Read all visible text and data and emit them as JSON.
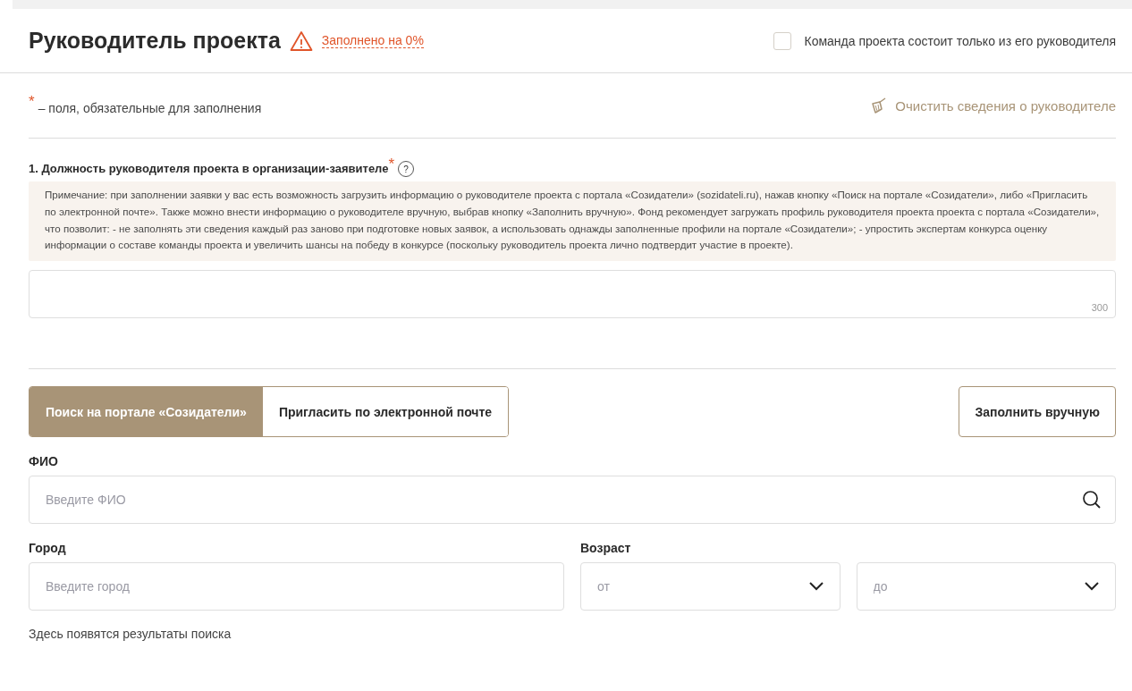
{
  "header": {
    "title": "Руководитель проекта",
    "progress": "Заполнено на 0%",
    "team_checkbox": {
      "label": "Команда проекта состоит только из его руководителя",
      "checked": false
    }
  },
  "required_note": {
    "mark": "*",
    "text": "– поля, обязательные для заполнения"
  },
  "clear_link": "Очистить сведения о руководителе",
  "question": {
    "label": "1. Должность руководителя проекта в организации-заявителе",
    "mark": "*",
    "help": "?",
    "note": "Примечание: при заполнении заявки у вас есть возможность загрузить информацию о руководителе проекта с портала «Созидатели» (sozidateli.ru), нажав кнопку «Поиск на портале «Созидатели», либо «Пригласить по электронной почте». Также можно внести информацию о руководителе вручную, выбрав кнопку «Заполнить вручную». Фонд рекомендует загружать профиль руководителя проекта проекта с портала «Созидатели», что позволит: - не заполнять эти сведения каждый раз заново при подготовке новых заявок, а использовать однажды заполненные профили на портале «Созидатели»; - упростить экспертам конкурса оценку информации о составе команды проекта и увеличить шансы на победу в конкурсе (поскольку руководитель проекта лично подтвердит участие в проекте).",
    "counter": "300"
  },
  "tabs": [
    {
      "label": "Поиск на портале «Созидатели»",
      "selected": true
    },
    {
      "label": "Пригласить по электронной почте",
      "selected": false
    }
  ],
  "manual_button": "Заполнить вручную",
  "fio": {
    "label": "ФИО",
    "placeholder": "Введите ФИО"
  },
  "city": {
    "label": "Город",
    "placeholder": "Введите город"
  },
  "age": {
    "label": "Возраст",
    "from_placeholder": "от",
    "to_placeholder": "до"
  },
  "results_hint": "Здесь появятся результаты поиска"
}
